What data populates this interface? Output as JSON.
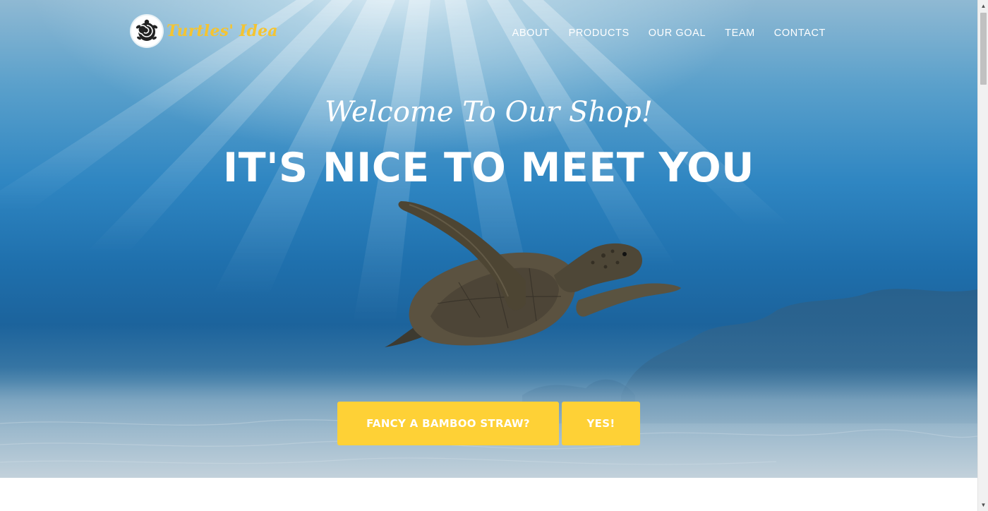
{
  "brand": {
    "name": "Turtles' Idea",
    "logo_icon": "turtle-spiral-icon"
  },
  "nav": {
    "items": [
      {
        "label": "ABOUT"
      },
      {
        "label": "PRODUCTS"
      },
      {
        "label": "OUR GOAL"
      },
      {
        "label": "TEAM"
      },
      {
        "label": "CONTACT"
      }
    ]
  },
  "hero": {
    "subheading": "Welcome To Our Shop!",
    "heading": "IT'S NICE TO MEET YOU",
    "buttons": {
      "straw_label": "FANCY A BAMBOO STRAW?",
      "yes_label": "YES!"
    },
    "image_subject": "sea-turtle-underwater"
  },
  "colors": {
    "accent": "#fed136",
    "logo_text": "#f4c431",
    "nav_text": "#ffffff",
    "ocean": "#2f86c2"
  },
  "scrollbar": {
    "position_fraction": 0.0
  }
}
